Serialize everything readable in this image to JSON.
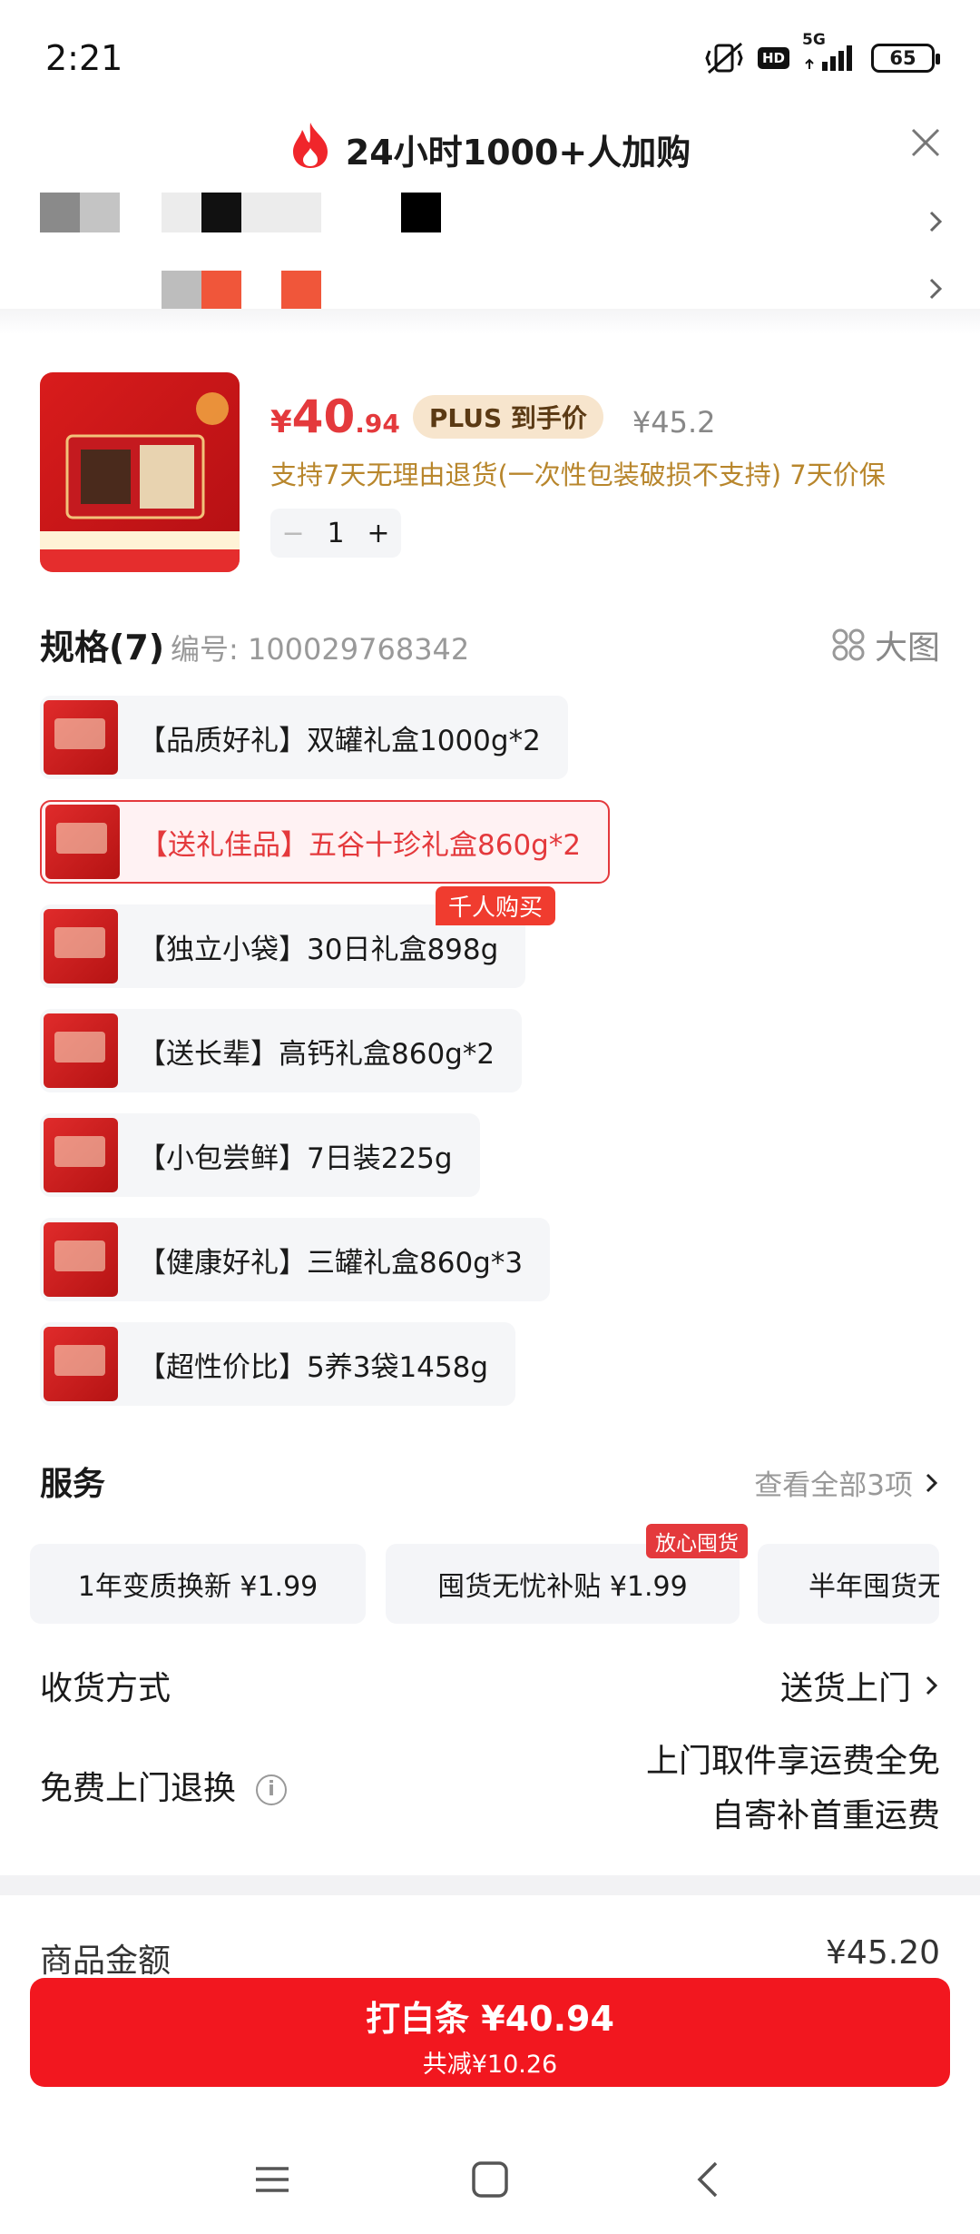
{
  "status_bar": {
    "time": "2:21",
    "icons": [
      "vibrate-off-icon",
      "hd-icon",
      "5g-signal-icon",
      "battery-icon"
    ],
    "hd": "HD",
    "network": "5G",
    "battery": "65"
  },
  "header": {
    "icon": "flame-icon",
    "title": "24小时1000+人加购",
    "close_icon": "close-icon"
  },
  "product": {
    "price_currency": "¥",
    "price_integer": "40",
    "price_decimal": ".94",
    "plus_tag": "PLUS 到手价",
    "original_price": "¥45.2",
    "guarantee": "支持7天无理由退货(一次性包装破损不支持)  7天价保",
    "quantity": "1",
    "minus": "−",
    "plus": "+"
  },
  "spec": {
    "title": "规格(7)",
    "code": "编号: 100029768342",
    "big_image_label": "大图",
    "hot_badge": "千人购买",
    "variants": [
      {
        "label": "【品质好礼】双罐礼盒1000g*2"
      },
      {
        "label": "【送礼佳品】五谷十珍礼盒860g*2"
      },
      {
        "label": "【独立小袋】30日礼盒898g"
      },
      {
        "label": "【送长辈】高钙礼盒860g*2"
      },
      {
        "label": "【小包尝鲜】7日装225g"
      },
      {
        "label": "【健康好礼】三罐礼盒860g*3"
      },
      {
        "label": "【超性价比】5养3袋1458g"
      }
    ]
  },
  "services": {
    "title": "服务",
    "more": "查看全部3项",
    "tag": "放心囤货",
    "items": [
      {
        "label": "1年变质换新  ¥1.99"
      },
      {
        "label": "囤货无忧补贴  ¥1.99"
      },
      {
        "label": "半年囤货无"
      }
    ]
  },
  "delivery": {
    "label": "收货方式",
    "value": "送货上门"
  },
  "return": {
    "label": "免费上门退换",
    "line1": "上门取件享运费全免",
    "line2": "自寄补首重运费"
  },
  "total": {
    "label": "商品金额",
    "value": "¥45.20"
  },
  "pay": {
    "main": "打白条 ¥40.94",
    "sub": "共减¥10.26"
  },
  "colors": {
    "accent": "#e4393c",
    "pay_button": "#f2171f",
    "plus_tag_bg": "#f7e5cd",
    "guarantee_text": "#b8862c"
  }
}
